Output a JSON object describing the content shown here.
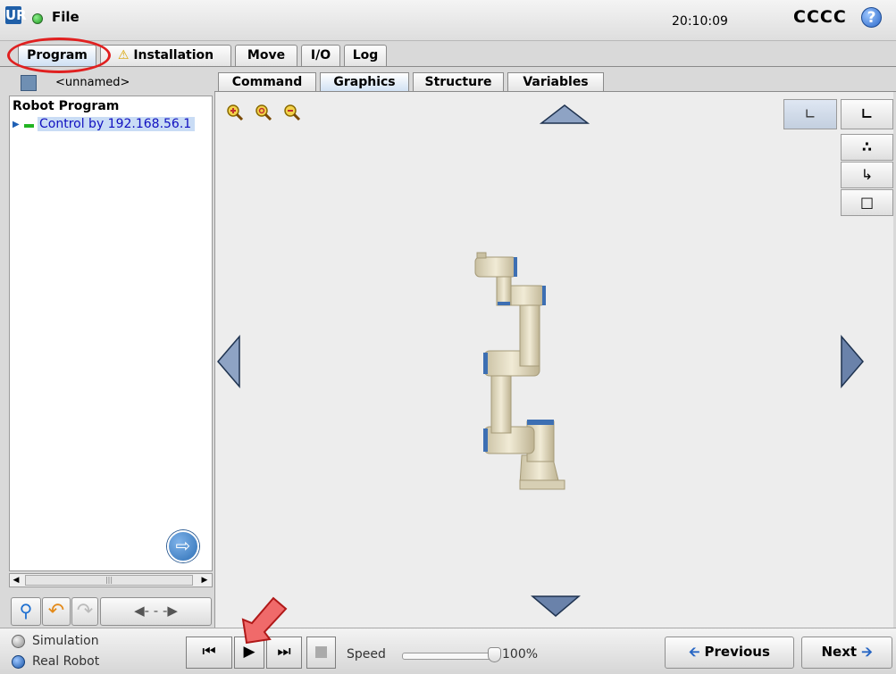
{
  "app": {
    "logo": "UR",
    "file_menu": "File",
    "clock": "20:10:09",
    "robot_name": "CCCC",
    "help_icon": "?"
  },
  "top_tabs": {
    "program": "Program",
    "installation": "Installation",
    "move": "Move",
    "io": "I/O",
    "log": "Log"
  },
  "program_panel": {
    "program_name": "<unnamed>",
    "tree_root": "Robot Program",
    "tree_child": "Control by 192.168.56.1"
  },
  "sub_tabs": {
    "command": "Command",
    "graphics": "Graphics",
    "structure": "Structure",
    "variables": "Variables"
  },
  "bottom": {
    "simulation_label": "Simulation",
    "real_robot_label": "Real Robot",
    "speed_label": "Speed",
    "speed_value": "100%",
    "speed_fraction": 1.0,
    "previous_label": "Previous",
    "next_label": "Next"
  },
  "colors": {
    "accent": "#2766c4",
    "highlight": "#c9dcf5",
    "annotation_red": "#e02020"
  },
  "icons": {
    "zoom_in": "zoom-in-icon",
    "zoom_reset": "zoom-reset-icon",
    "zoom_out": "zoom-out-icon",
    "goto": "goto-arrow-icon",
    "warning": "warning-icon"
  }
}
